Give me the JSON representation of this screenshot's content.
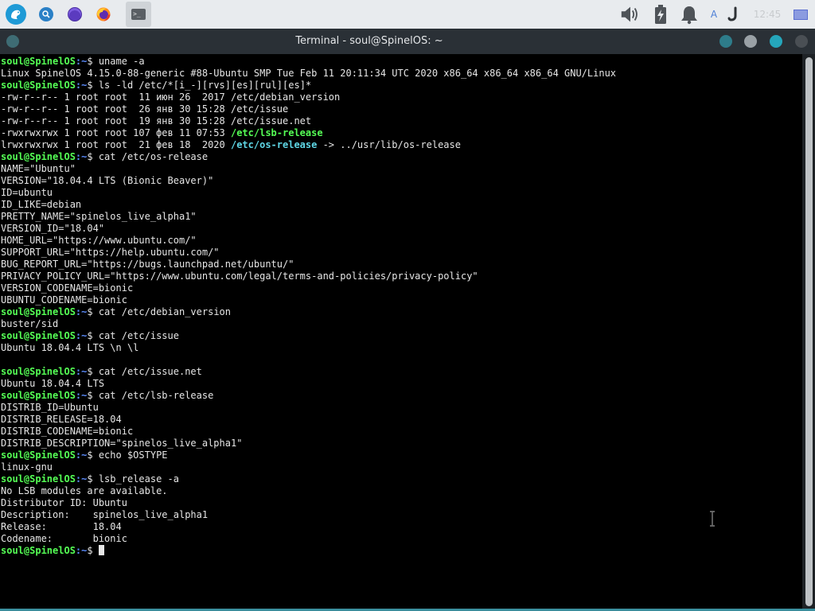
{
  "panel": {
    "launchers": [
      "app-menu-icon",
      "search-icon",
      "app-icon",
      "firefox-icon",
      "terminal-icon"
    ],
    "clock": "12:45",
    "keyboard_layout": "A",
    "tray_icons": [
      "volume-icon",
      "battery-icon",
      "notifications-icon",
      "keyboard-layout-icon",
      "updates-icon",
      "show-desktop-icon"
    ]
  },
  "window": {
    "title": "Terminal - soul@SpinelOS: ~"
  },
  "terminal": {
    "prompt_user": "soul@SpinelOS",
    "prompt_path": ":~",
    "prompt_symbol": "$ ",
    "lines": [
      {
        "type": "cmd",
        "text": "uname -a"
      },
      {
        "type": "out",
        "text": "Linux SpinelOS 4.15.0-88-generic #88-Ubuntu SMP Tue Feb 11 20:11:34 UTC 2020 x86_64 x86_64 x86_64 GNU/Linux"
      },
      {
        "type": "cmd",
        "text": "ls -ld /etc/*[i_-][rvs][es][rul][es]*"
      },
      {
        "type": "out",
        "text": "-rw-r--r-- 1 root root  11 июн 26  2017 /etc/debian_version"
      },
      {
        "type": "out",
        "text": "-rw-r--r-- 1 root root  26 янв 30 15:28 /etc/issue"
      },
      {
        "type": "out",
        "text": "-rw-r--r-- 1 root root  19 янв 30 15:28 /etc/issue.net"
      },
      {
        "type": "out",
        "text": "-rwxrwxrwx 1 root root 107 фев 11 07:53 ",
        "hl": "/etc/lsb-release",
        "hl_class": "hl-green"
      },
      {
        "type": "out",
        "text": "lrwxrwxrwx 1 root root  21 фев 18  2020 ",
        "hl": "/etc/os-release",
        "hl_class": "hl-teal",
        "tail": " -> ../usr/lib/os-release"
      },
      {
        "type": "cmd",
        "text": "cat /etc/os-release"
      },
      {
        "type": "out",
        "text": "NAME=\"Ubuntu\""
      },
      {
        "type": "out",
        "text": "VERSION=\"18.04.4 LTS (Bionic Beaver)\""
      },
      {
        "type": "out",
        "text": "ID=ubuntu"
      },
      {
        "type": "out",
        "text": "ID_LIKE=debian"
      },
      {
        "type": "out",
        "text": "PRETTY_NAME=\"spinelos_live_alpha1\""
      },
      {
        "type": "out",
        "text": "VERSION_ID=\"18.04\""
      },
      {
        "type": "out",
        "text": "HOME_URL=\"https://www.ubuntu.com/\""
      },
      {
        "type": "out",
        "text": "SUPPORT_URL=\"https://help.ubuntu.com/\""
      },
      {
        "type": "out",
        "text": "BUG_REPORT_URL=\"https://bugs.launchpad.net/ubuntu/\""
      },
      {
        "type": "out",
        "text": "PRIVACY_POLICY_URL=\"https://www.ubuntu.com/legal/terms-and-policies/privacy-policy\""
      },
      {
        "type": "out",
        "text": "VERSION_CODENAME=bionic"
      },
      {
        "type": "out",
        "text": "UBUNTU_CODENAME=bionic"
      },
      {
        "type": "cmd",
        "text": "cat /etc/debian_version"
      },
      {
        "type": "out",
        "text": "buster/sid"
      },
      {
        "type": "cmd",
        "text": "cat /etc/issue"
      },
      {
        "type": "out",
        "text": "Ubuntu 18.04.4 LTS \\n \\l"
      },
      {
        "type": "out",
        "text": ""
      },
      {
        "type": "cmd",
        "text": "cat /etc/issue.net"
      },
      {
        "type": "out",
        "text": "Ubuntu 18.04.4 LTS"
      },
      {
        "type": "cmd",
        "text": "cat /etc/lsb-release"
      },
      {
        "type": "out",
        "text": "DISTRIB_ID=Ubuntu"
      },
      {
        "type": "out",
        "text": "DISTRIB_RELEASE=18.04"
      },
      {
        "type": "out",
        "text": "DISTRIB_CODENAME=bionic"
      },
      {
        "type": "out",
        "text": "DISTRIB_DESCRIPTION=\"spinelos_live_alpha1\""
      },
      {
        "type": "cmd",
        "text": "echo $OSTYPE"
      },
      {
        "type": "out",
        "text": "linux-gnu"
      },
      {
        "type": "cmd",
        "text": "lsb_release -a"
      },
      {
        "type": "out",
        "text": "No LSB modules are available."
      },
      {
        "type": "out",
        "text": "Distributor ID:\tUbuntu"
      },
      {
        "type": "out",
        "text": "Description:\tspinelos_live_alpha1"
      },
      {
        "type": "out",
        "text": "Release:\t18.04"
      },
      {
        "type": "out",
        "text": "Codename:\tbionic"
      },
      {
        "type": "cmd",
        "text": "",
        "cursor": true
      }
    ]
  }
}
